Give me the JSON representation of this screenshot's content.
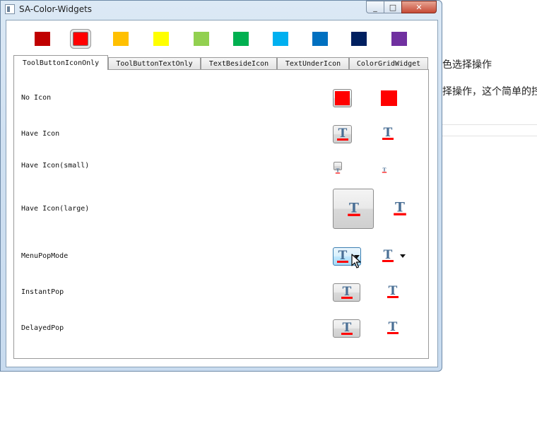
{
  "window": {
    "title": "SA-Color-Widgets",
    "controls": {
      "minimize": "_",
      "maximize": "□",
      "close": "✕"
    }
  },
  "background": {
    "line1": "色选择操作",
    "line2": "择操作，这个简单的控"
  },
  "swatches": [
    {
      "name": "dark-red",
      "color": "#c00000",
      "selected": false
    },
    {
      "name": "red",
      "color": "#ff0000",
      "selected": true
    },
    {
      "name": "orange",
      "color": "#ffc000",
      "selected": false
    },
    {
      "name": "yellow",
      "color": "#ffff00",
      "selected": false
    },
    {
      "name": "light-green",
      "color": "#92d050",
      "selected": false
    },
    {
      "name": "green",
      "color": "#00b050",
      "selected": false
    },
    {
      "name": "light-blue",
      "color": "#00b0f0",
      "selected": false
    },
    {
      "name": "blue",
      "color": "#0070c0",
      "selected": false
    },
    {
      "name": "dark-blue",
      "color": "#002060",
      "selected": false
    },
    {
      "name": "purple",
      "color": "#7030a0",
      "selected": false
    }
  ],
  "tabs": [
    {
      "label": "ToolButtonIconOnly",
      "active": true
    },
    {
      "label": "ToolButtonTextOnly",
      "active": false
    },
    {
      "label": "TextBesideIcon",
      "active": false
    },
    {
      "label": "TextUnderIcon",
      "active": false
    },
    {
      "label": "ColorGridWidget",
      "active": false
    }
  ],
  "rows": {
    "no_icon": "No Icon",
    "have_icon": "Have Icon",
    "have_icon_small": "Have Icon(small)",
    "have_icon_large": "Have Icon(large)",
    "menu_pop_mode": "MenuPopMode",
    "instant_pop": "InstantPop",
    "delayed_pop": "DelayedPop"
  },
  "icon": {
    "glyph": "T",
    "glyph_color": "#4a6f95",
    "underline_color": "#ff0000"
  },
  "colors": {
    "current": "#ff0000"
  }
}
